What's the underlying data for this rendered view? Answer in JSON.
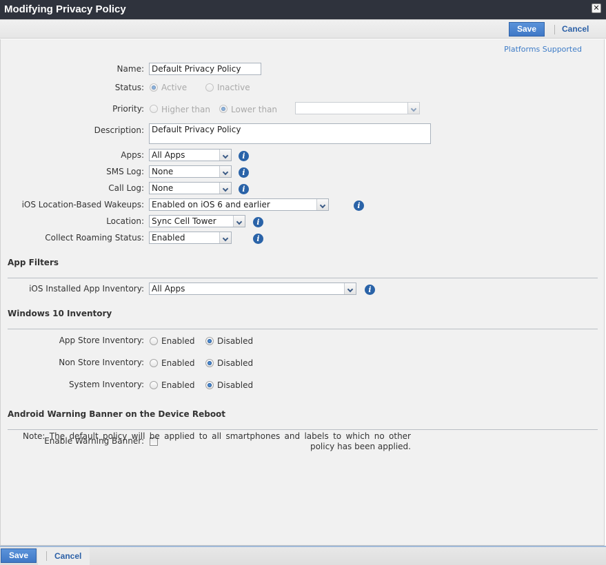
{
  "window": {
    "title": "Modifying Privacy Policy",
    "close_icon": "close-icon"
  },
  "toolbar": {
    "save_label": "Save",
    "cancel_label": "Cancel"
  },
  "links": {
    "platforms_supported": "Platforms Supported"
  },
  "form": {
    "name": {
      "label": "Name:",
      "value": "Default Privacy Policy"
    },
    "status": {
      "label": "Status:",
      "options": [
        {
          "label": "Active",
          "selected": true
        },
        {
          "label": "Inactive",
          "selected": false
        }
      ]
    },
    "priority": {
      "label": "Priority:",
      "options": [
        {
          "label": "Higher than",
          "selected": false
        },
        {
          "label": "Lower than",
          "selected": true
        }
      ],
      "select_value": ""
    },
    "description": {
      "label": "Description:",
      "value": "Default Privacy Policy"
    },
    "apps": {
      "label": "Apps:",
      "value": "All Apps"
    },
    "sms_log": {
      "label": "SMS Log:",
      "value": "None"
    },
    "call_log": {
      "label": "Call Log:",
      "value": "None"
    },
    "ios_wakeups": {
      "label": "iOS Location-Based Wakeups:",
      "value": "Enabled on iOS 6 and earlier"
    },
    "location": {
      "label": "Location:",
      "value": "Sync Cell Tower"
    },
    "roaming": {
      "label": "Collect Roaming Status:",
      "value": "Enabled"
    }
  },
  "sections": {
    "app_filters": {
      "title": "App Filters",
      "ios_installed": {
        "label": "iOS Installed App Inventory:",
        "value": "All Apps"
      }
    },
    "win10": {
      "title": "Windows 10 Inventory",
      "rows": [
        {
          "label": "App Store Inventory:",
          "enabled_label": "Enabled",
          "disabled_label": "Disabled",
          "selected": "Disabled"
        },
        {
          "label": "Non Store Inventory:",
          "enabled_label": "Enabled",
          "disabled_label": "Disabled",
          "selected": "Disabled"
        },
        {
          "label": "System Inventory:",
          "enabled_label": "Enabled",
          "disabled_label": "Disabled",
          "selected": "Disabled"
        }
      ]
    },
    "android_banner": {
      "title": "Android Warning Banner on the Device Reboot",
      "enable_label": "Enable Warning Banner:",
      "enabled": false
    }
  },
  "note": "Note: The default policy will be applied to all smartphones and labels to which no other policy has been applied.",
  "colors": {
    "titlebar": "#2f333d",
    "accent": "#3f78c6",
    "link": "#2a5fa6",
    "info": "#2a63a8"
  }
}
